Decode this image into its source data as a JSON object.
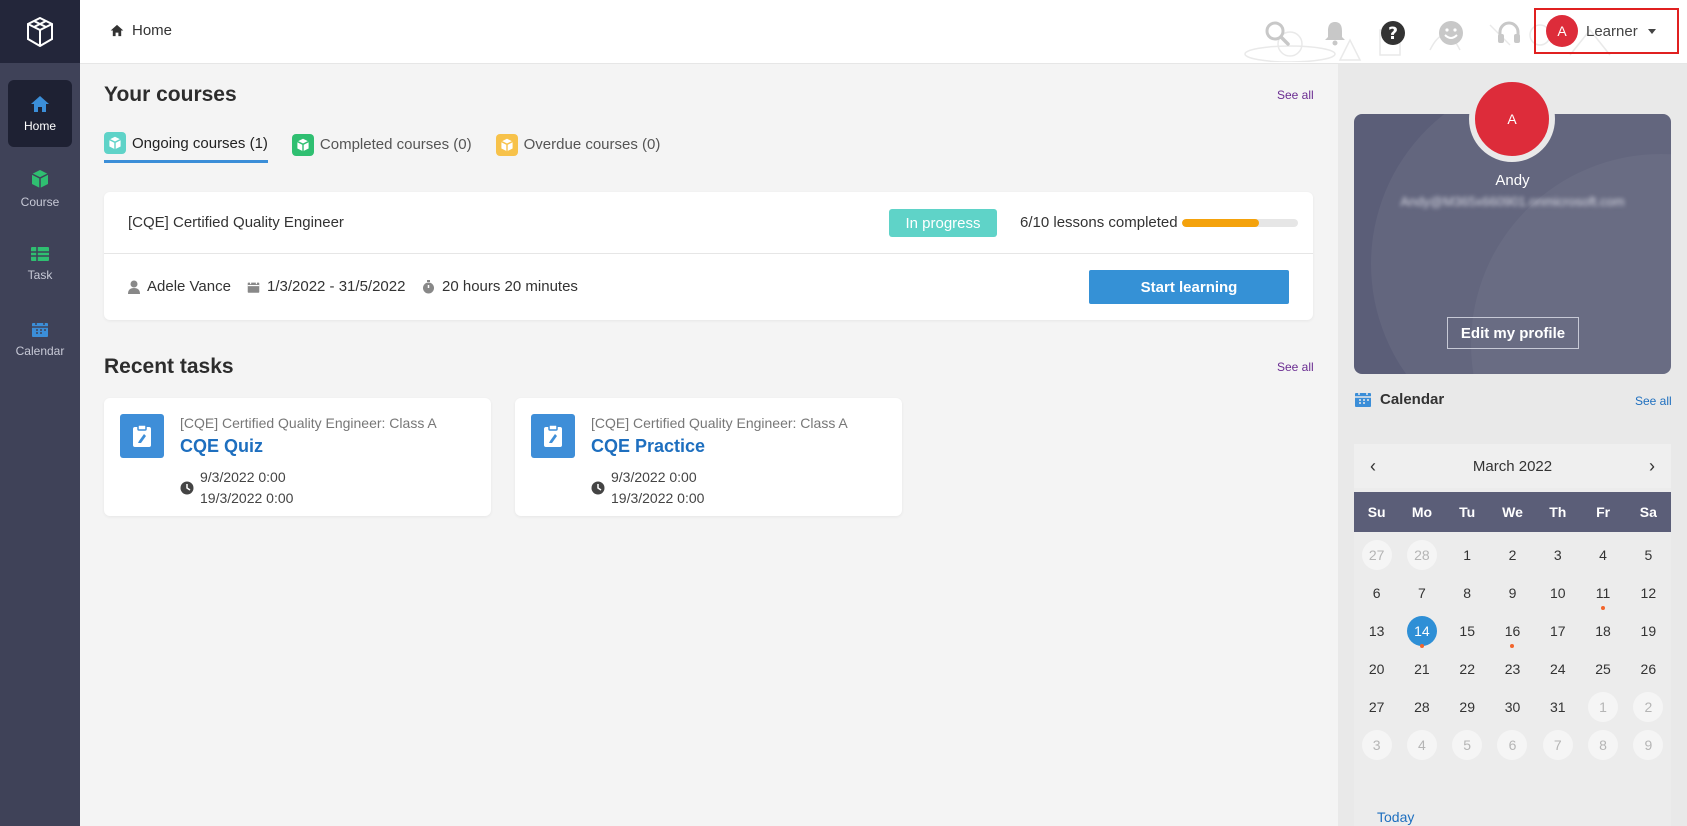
{
  "sidebar": {
    "items": [
      {
        "label": "Home",
        "icon": "home-icon"
      },
      {
        "label": "Course",
        "icon": "cube-icon"
      },
      {
        "label": "Task",
        "icon": "task-icon"
      },
      {
        "label": "Calendar",
        "icon": "calendar-icon"
      }
    ]
  },
  "topbar": {
    "breadcrumb": "Home",
    "user": {
      "initial": "A",
      "role": "Learner"
    }
  },
  "courses": {
    "title": "Your courses",
    "see_all": "See all",
    "tabs": [
      {
        "label": "Ongoing courses (1)",
        "color": "#5fd3c8"
      },
      {
        "label": "Completed courses (0)",
        "color": "#2fbf71"
      },
      {
        "label": "Overdue courses (0)",
        "color": "#f7c24a"
      }
    ],
    "card": {
      "name": "[CQE] Certified Quality Engineer",
      "status": "In progress",
      "lessons": "6/10 lessons completed",
      "progress": 0.66,
      "instructor": "Adele Vance",
      "dates": "1/3/2022 - 31/5/2022",
      "duration": "20 hours 20 minutes",
      "button": "Start learning"
    }
  },
  "tasks": {
    "title": "Recent tasks",
    "see_all": "See all",
    "items": [
      {
        "class": "[CQE] Certified Quality Engineer: Class A",
        "name": "CQE Quiz",
        "start": "9/3/2022 0:00",
        "end": "19/3/2022 0:00"
      },
      {
        "class": "[CQE] Certified Quality Engineer: Class A",
        "name": "CQE Practice",
        "start": "9/3/2022 0:00",
        "end": "19/3/2022 0:00"
      }
    ]
  },
  "profile": {
    "initial": "A",
    "name": "Andy",
    "email": "Andy@M365x660901.onmicrosoft.com",
    "edit": "Edit my profile"
  },
  "calendar": {
    "title": "Calendar",
    "see_all": "See all",
    "month": "March 2022",
    "prev": "‹",
    "next": "›",
    "weekdays": [
      "Su",
      "Mo",
      "Tu",
      "We",
      "Th",
      "Fr",
      "Sa"
    ],
    "days": [
      {
        "d": "27",
        "out": true
      },
      {
        "d": "28",
        "out": true
      },
      {
        "d": "1"
      },
      {
        "d": "2"
      },
      {
        "d": "3"
      },
      {
        "d": "4"
      },
      {
        "d": "5"
      },
      {
        "d": "6"
      },
      {
        "d": "7"
      },
      {
        "d": "8"
      },
      {
        "d": "9"
      },
      {
        "d": "10"
      },
      {
        "d": "11",
        "dot": true
      },
      {
        "d": "12"
      },
      {
        "d": "13"
      },
      {
        "d": "14",
        "today": true,
        "dot": true
      },
      {
        "d": "15"
      },
      {
        "d": "16",
        "dot": true
      },
      {
        "d": "17"
      },
      {
        "d": "18"
      },
      {
        "d": "19"
      },
      {
        "d": "20"
      },
      {
        "d": "21"
      },
      {
        "d": "22"
      },
      {
        "d": "23"
      },
      {
        "d": "24"
      },
      {
        "d": "25"
      },
      {
        "d": "26"
      },
      {
        "d": "27"
      },
      {
        "d": "28"
      },
      {
        "d": "29"
      },
      {
        "d": "30"
      },
      {
        "d": "31"
      },
      {
        "d": "1",
        "out": true
      },
      {
        "d": "2",
        "out": true
      },
      {
        "d": "3",
        "out": true
      },
      {
        "d": "4",
        "out": true
      },
      {
        "d": "5",
        "out": true
      },
      {
        "d": "6",
        "out": true
      },
      {
        "d": "7",
        "out": true
      },
      {
        "d": "8",
        "out": true
      },
      {
        "d": "9",
        "out": true
      }
    ],
    "today_label": "Today"
  },
  "colors": {
    "accent": "#3591d6",
    "sidebar": "#3f4258",
    "badge": "#5fd3c8",
    "progress": "#f4a20c",
    "avatar": "#dd2c3a"
  }
}
